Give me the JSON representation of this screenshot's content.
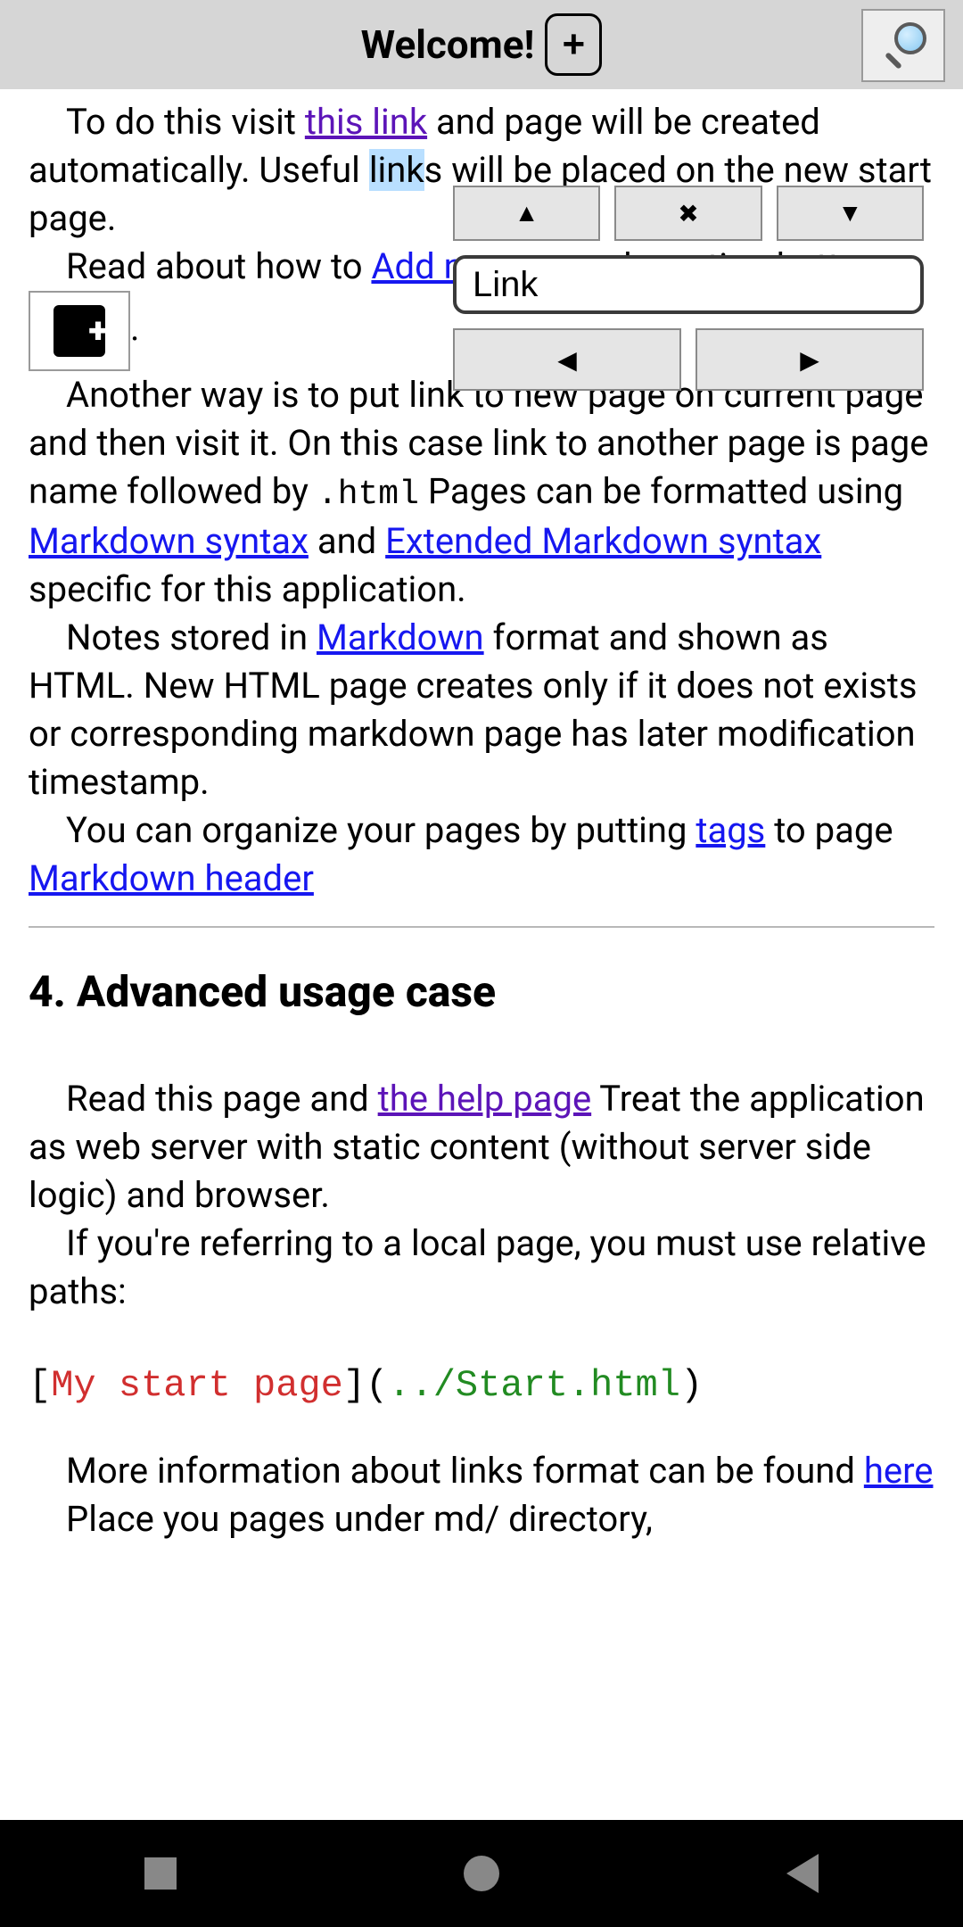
{
  "titlebar": {
    "title": "Welcome!",
    "add_label": "+"
  },
  "find": {
    "up": "▲",
    "close": "✖",
    "down": "▼",
    "value": "Link",
    "prev": "◀",
    "next": "▶"
  },
  "body": {
    "p1_a": "To do this visit ",
    "p1_link": "this link",
    "p1_b": " and page will be created automatically. Useful ",
    "p1_hl": "link",
    "p1_c": "s will be placed on the new start page.",
    "p2_a": "Read about how to ",
    "p2_link": "Add new pages",
    "p2_b": " by action button ",
    "p2_c": ".",
    "p3_a": "Another way is to put link to new page on current page and then visit it. On this case link to another page is page name followed by ",
    "p3_code": ".html",
    "p3_b": " Pages can be formatted using ",
    "p3_link1": "Markdown syntax",
    "p3_c": " and ",
    "p3_link2": "Extended Markdown syntax",
    "p3_d": " specific for this application.",
    "p4_a": "Notes stored in ",
    "p4_link": "Markdown",
    "p4_b": " format and shown as HTML. New HTML page creates only if it does not exists or corresponding markdown page has later modification timestamp.",
    "p5_a": "You can organize your pages by putting ",
    "p5_link1": "tags",
    "p5_b": " to page ",
    "p5_link2": "Markdown header",
    "h2": "4. Advanced usage case",
    "p6_a": "Read this page and ",
    "p6_link": "the help page",
    "p6_b": " Treat the application as web server with static content (without server side logic) and browser.",
    "p7": "If you're referring to a local page, you must use relative paths:",
    "code_br1": "[",
    "code_txt": "My start page",
    "code_br2": "](",
    "code_path": "../Start.html",
    "code_br3": ")",
    "p8_a": "More information about links format can be found ",
    "p8_link": "here",
    "p9": "Place you pages under md/ directory,"
  }
}
